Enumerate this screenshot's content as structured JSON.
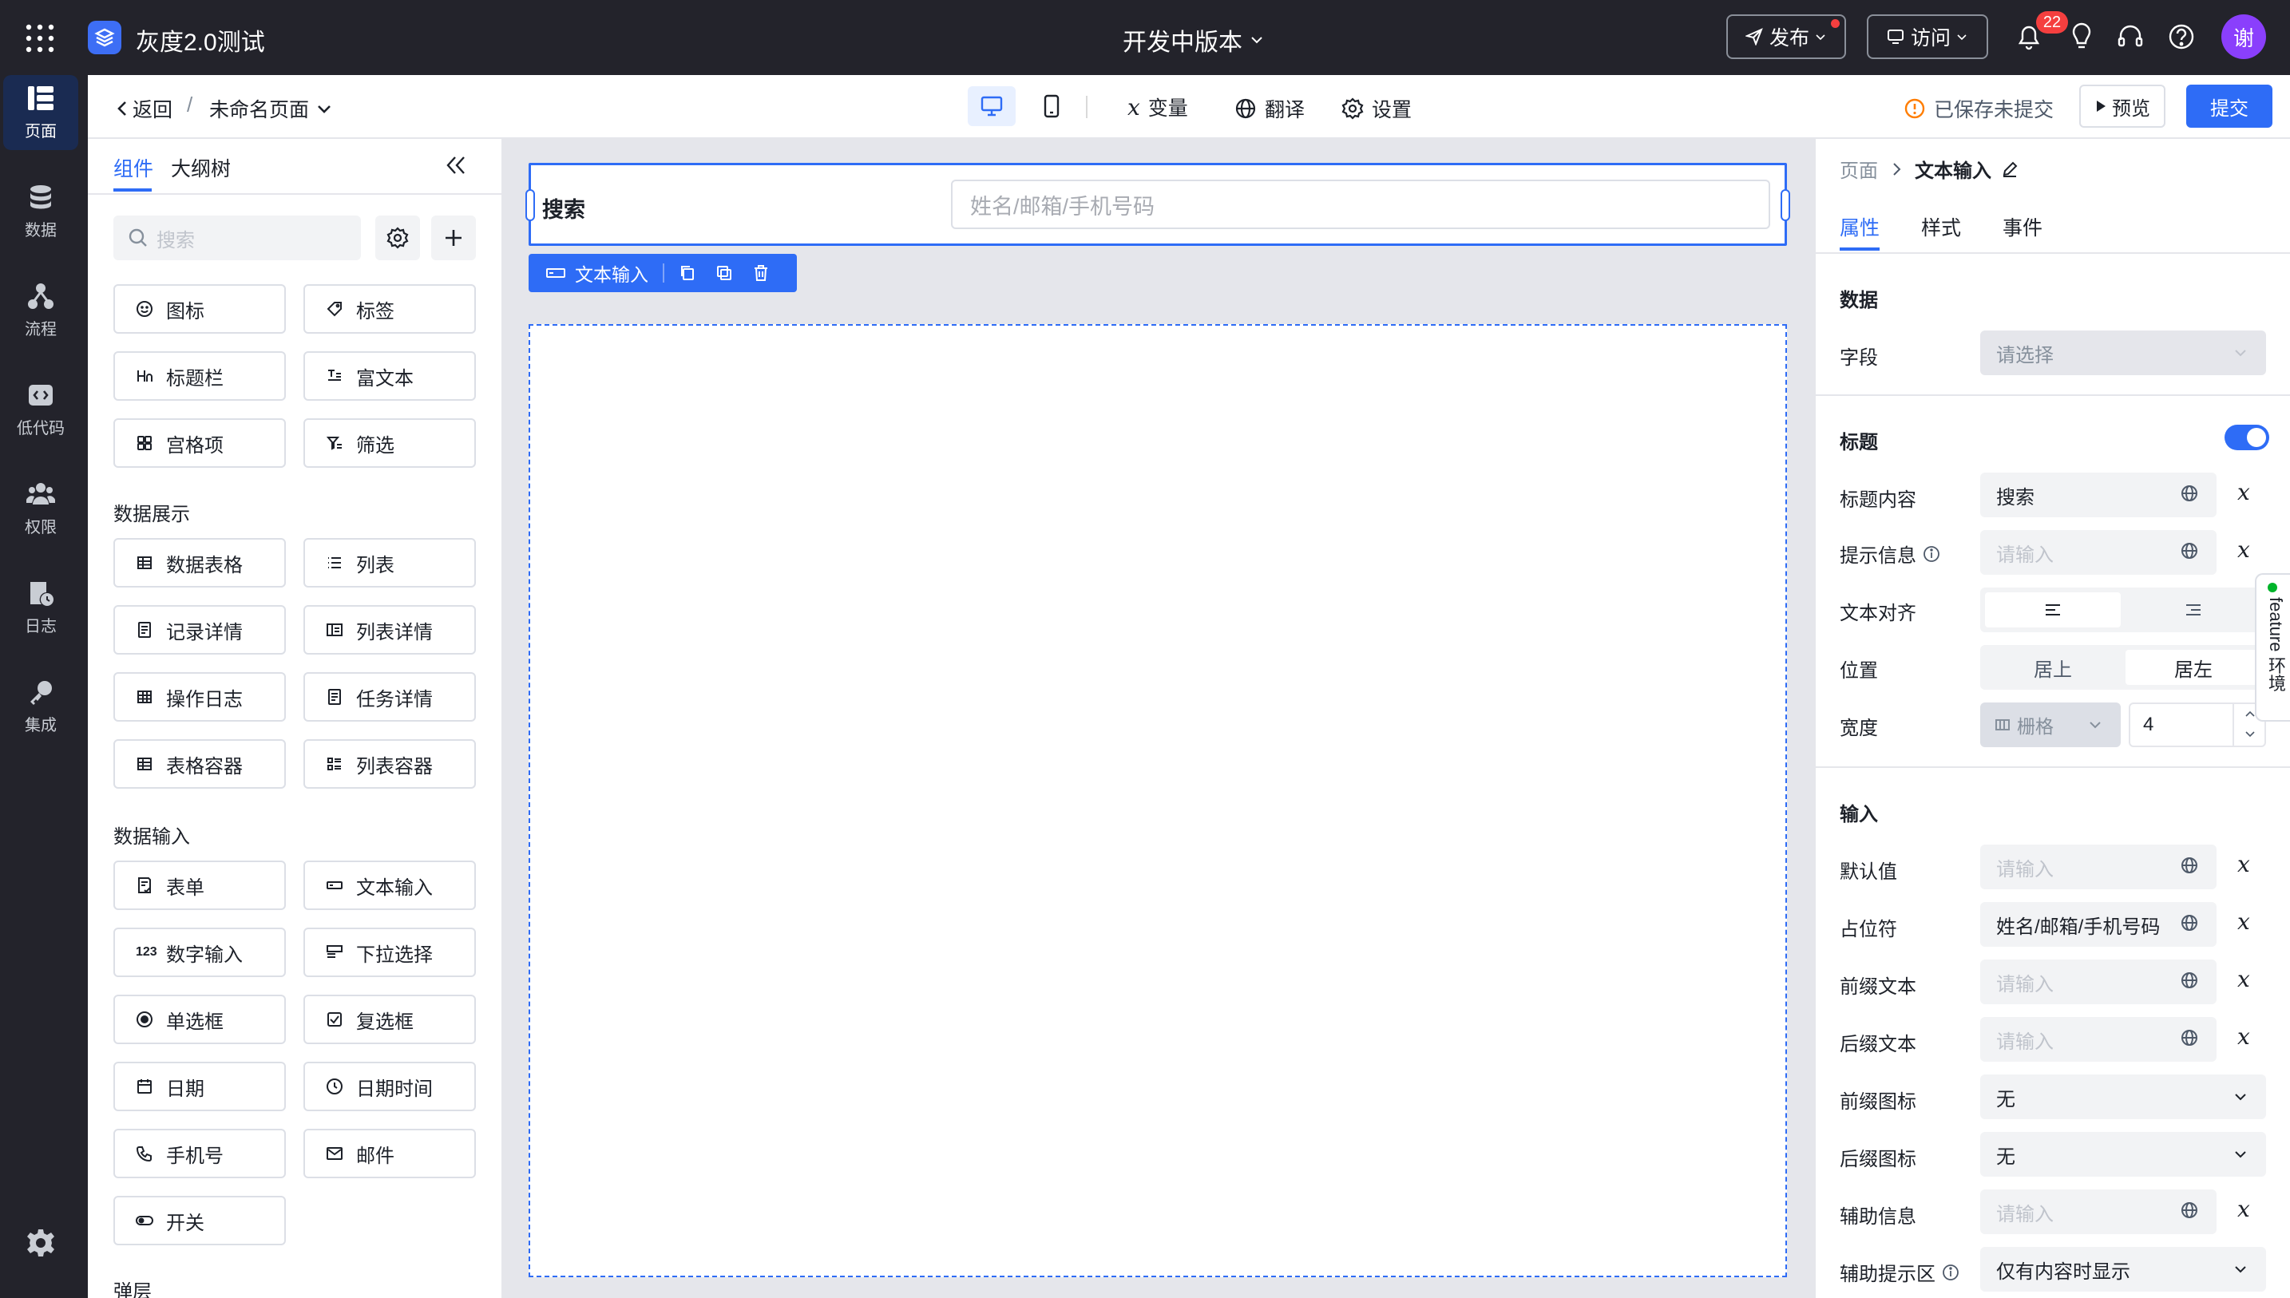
{
  "app": {
    "title": "灰度2.0测试",
    "version_label": "开发中版本",
    "publish_label": "发布",
    "visit_label": "访问",
    "notif_count": "22",
    "avatar_text": "谢"
  },
  "nav": {
    "items": [
      "页面",
      "数据",
      "流程",
      "低代码",
      "权限",
      "日志",
      "集成"
    ]
  },
  "subbar": {
    "back": "返回",
    "page_name": "未命名页面",
    "var_label": "变量",
    "translate_label": "翻译",
    "settings_label": "设置",
    "saved_status": "已保存未提交",
    "preview_label": "预览",
    "submit_label": "提交"
  },
  "components": {
    "tabs": [
      "组件",
      "大纲树"
    ],
    "search_placeholder": "搜索",
    "basic": [
      "图标",
      "标签",
      "标题栏",
      "富文本",
      "宫格项",
      "筛选"
    ],
    "section_display": "数据展示",
    "display": [
      "数据表格",
      "列表",
      "记录详情",
      "列表详情",
      "操作日志",
      "任务详情",
      "表格容器",
      "列表容器"
    ],
    "section_input": "数据输入",
    "input": [
      "表单",
      "文本输入",
      "数字输入",
      "下拉选择",
      "单选框",
      "复选框",
      "日期",
      "日期时间",
      "手机号",
      "邮件",
      "开关"
    ],
    "section_popup": "弹层"
  },
  "canvas": {
    "field_label": "搜索",
    "placeholder": "姓名/邮箱/手机号码",
    "toolbar_label": "文本输入"
  },
  "props": {
    "breadcrumb_root": "页面",
    "breadcrumb_current": "文本输入",
    "tabs": [
      "属性",
      "样式",
      "事件"
    ],
    "section_data": "数据",
    "field_label": "字段",
    "field_placeholder": "请选择",
    "section_title": "标题",
    "title_content_label": "标题内容",
    "title_content_value": "搜索",
    "hint_label": "提示信息",
    "input_placeholder": "请输入",
    "align_label": "文本对齐",
    "position_label": "位置",
    "position_top": "居上",
    "position_left": "居左",
    "width_label": "宽度",
    "width_mode": "栅格",
    "width_value": "4",
    "section_input": "输入",
    "default_label": "默认值",
    "placeholder_label": "占位符",
    "placeholder_value": "姓名/邮箱/手机号码",
    "prefix_text_label": "前缀文本",
    "suffix_text_label": "后缀文本",
    "prefix_icon_label": "前缀图标",
    "prefix_icon_value": "无",
    "suffix_icon_label": "后缀图标",
    "suffix_icon_value": "无",
    "aux_label": "辅助信息",
    "aux_area_label": "辅助提示区",
    "aux_area_value": "仅有内容时显示",
    "var_symbol": "𝑥"
  },
  "feature_tab": "feature 环境",
  "colors": {
    "primary": "#2e6cf6",
    "topbar": "#23232b",
    "badge": "#f53f3f",
    "avatar": "#8a3ffc"
  }
}
